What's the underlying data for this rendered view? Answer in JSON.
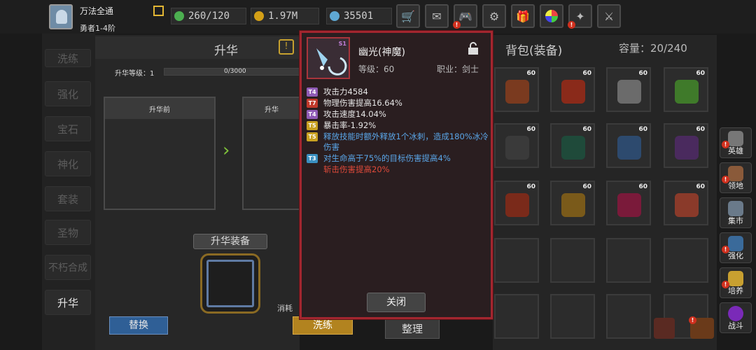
{
  "player": {
    "name": "万法全通",
    "rank": "勇者1-4阶"
  },
  "resources": [
    {
      "icon": "energy-icon",
      "value": "260/120",
      "color": "#4caf50"
    },
    {
      "icon": "gold-coin-icon",
      "value": "1.97M",
      "color": "#d4a017"
    },
    {
      "icon": "gem-icon",
      "value": "35501",
      "color": "#5fa8d3"
    }
  ],
  "topbar_buttons": [
    "shop-cart-icon",
    "mail-icon",
    "gamepad-icon",
    "settings-gear-icon",
    "gift-icon",
    "lucky-wheel-icon",
    "event-icon",
    "battle-swords-icon"
  ],
  "left_menu": [
    "洗练",
    "强化",
    "宝石",
    "神化",
    "套装",
    "圣物",
    "不朽合成",
    "升华"
  ],
  "sublimation": {
    "title": "升华",
    "level_label": "升华等级：1",
    "progress_text": "0/3000",
    "before_label": "升华前",
    "after_label": "升华",
    "equip_label": "升华装备",
    "cost_label": "消耗",
    "replace_label": "替换",
    "refine_label": "洗练"
  },
  "bag": {
    "title": "背包(装备)",
    "capacity": "容量：20/240",
    "sort_label": "整理",
    "items": [
      {
        "level": "60",
        "color": "#7a3a1f"
      },
      {
        "level": "60",
        "color": "#8a2a1a"
      },
      {
        "level": "60",
        "color": "#6b6b6b"
      },
      {
        "level": "60",
        "color": "#3f7a2a"
      },
      {
        "level": "60",
        "color": "#3a3a3a"
      },
      {
        "level": "60",
        "color": "#1f4a3a"
      },
      {
        "level": "60",
        "color": "#2d4a6e"
      },
      {
        "level": "60",
        "color": "#4a2a5e"
      },
      {
        "level": "60",
        "color": "#7a2a1a"
      },
      {
        "level": "60",
        "color": "#7a5a1a"
      },
      {
        "level": "60",
        "color": "#7a1a3a"
      },
      {
        "level": "60",
        "color": "#8a3a2a"
      }
    ]
  },
  "side_nav": [
    {
      "label": "英雄",
      "icon": "hero-helmet-icon"
    },
    {
      "label": "领地",
      "icon": "territory-castle-icon"
    },
    {
      "label": "集市",
      "icon": "market-stall-icon"
    },
    {
      "label": "强化",
      "icon": "enhance-crystal-icon"
    },
    {
      "label": "培养",
      "icon": "cultivate-trophy-icon"
    },
    {
      "label": "战斗",
      "icon": "battle-portal-icon"
    }
  ],
  "tooltip": {
    "badge": "S1",
    "name": "幽光(神魔)",
    "level": "等级：60",
    "job": "职业：剑士",
    "close_label": "关闭",
    "attributes": [
      {
        "tier": "T4",
        "text": "攻击力4584",
        "color": "#e6e6e6",
        "tier_color": "#8f5bb5"
      },
      {
        "tier": "T7",
        "text": "物理伤害提高16.64%",
        "color": "#e6e6e6",
        "tier_color": "#c0392b"
      },
      {
        "tier": "T4",
        "text": "攻击速度14.04%",
        "color": "#e6e6e6",
        "tier_color": "#8f5bb5"
      },
      {
        "tier": "T5",
        "text": "暴击率-1.92%",
        "color": "#e6e6e6",
        "tier_color": "#c8a020"
      },
      {
        "tier": "T5",
        "text": "释放技能时额外释放1个冰刺，造成180%冰冷伤害",
        "color": "#5aa6e8",
        "tier_color": "#c8a020"
      },
      {
        "tier": "T3",
        "text": "对生命高于75%的目标伤害提高4%",
        "color": "#5aa6e8",
        "tier_color": "#3a8fc0"
      },
      {
        "tier": "",
        "text": "斩击伤害提高20%",
        "color": "#e04a3a",
        "tier_color": ""
      }
    ]
  }
}
